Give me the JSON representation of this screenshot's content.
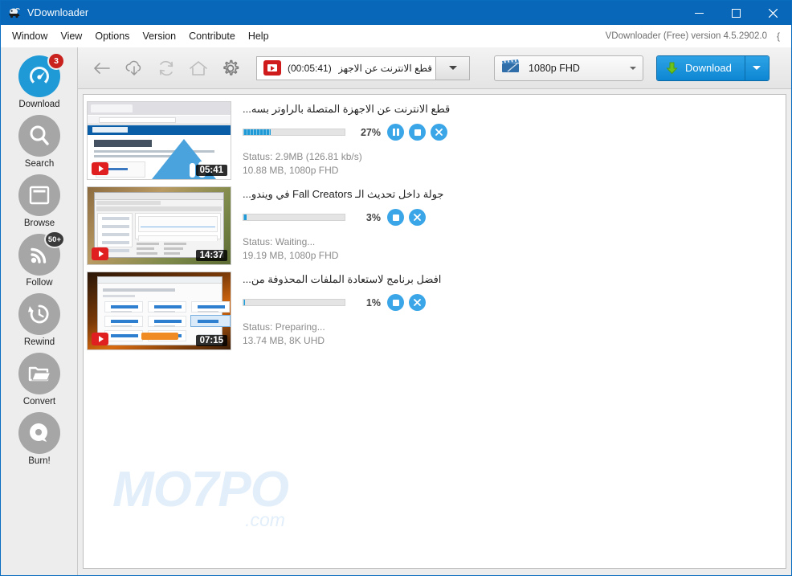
{
  "window": {
    "title": "VDownloader",
    "app_icon": "vdownloader-icon",
    "minimize_label": "—",
    "maximize_label": "□",
    "close_label": "✕"
  },
  "menubar": {
    "items": [
      {
        "label": "Window"
      },
      {
        "label": "View"
      },
      {
        "label": "Options"
      },
      {
        "label": "Version"
      },
      {
        "label": "Contribute"
      },
      {
        "label": "Help"
      }
    ],
    "version_text": "VDownloader (Free) version 4.5.2902.0",
    "version_glyph": "{"
  },
  "sidebar": {
    "items": [
      {
        "label": "Download",
        "icon": "speedometer-icon",
        "active": true,
        "badge": "3",
        "badge_style": "red"
      },
      {
        "label": "Search",
        "icon": "magnifier-icon",
        "active": false,
        "badge": null
      },
      {
        "label": "Browse",
        "icon": "window-icon",
        "active": false,
        "badge": null
      },
      {
        "label": "Follow",
        "icon": "rss-icon",
        "active": false,
        "badge": "50+",
        "badge_style": "dark"
      },
      {
        "label": "Rewind",
        "icon": "clock-rewind-icon",
        "active": false,
        "badge": null
      },
      {
        "label": "Convert",
        "icon": "folder-open-icon",
        "active": false,
        "badge": null
      },
      {
        "label": "Burn!",
        "icon": "disc-icon",
        "active": false,
        "badge": null
      }
    ]
  },
  "toolbar": {
    "icons": [
      {
        "name": "back-icon"
      },
      {
        "name": "cloud-download-icon"
      },
      {
        "name": "refresh-icon"
      },
      {
        "name": "home-icon"
      },
      {
        "name": "settings-gear-icon"
      }
    ],
    "url_field": {
      "text": "قطع الانترنت عن الاجهزة",
      "duration": "(00:05:41)",
      "source_icon": "youtube-icon"
    },
    "url_dropdown": "chevron-down-icon",
    "quality": {
      "value": "1080p FHD",
      "icon": "clapperboard-icon",
      "dropdown": "chevron-down-icon"
    },
    "download_button": {
      "label": "Download",
      "icon": "download-arrow-icon",
      "split_icon": "chevron-down-icon"
    }
  },
  "downloads": [
    {
      "title": "قطع الانترنت عن الاجهزة المتصلة بالراوتر بسه...",
      "duration": "05:41",
      "percent": "27%",
      "percent_value": 27,
      "status": "Status: 2.9MB (126.81 kb/s)",
      "meta": "10.88 MB,   1080p FHD",
      "source_icon": "youtube-icon",
      "controls": [
        "pause-button",
        "stop-button",
        "cancel-button"
      ],
      "thumb": "t1"
    },
    {
      "title": "جولة داخل تحديث الـ Fall Creators في ويندو...",
      "duration": "14:37",
      "percent": "3%",
      "percent_value": 3,
      "status": "Status: Waiting...",
      "meta": "19.19 MB,   1080p FHD",
      "source_icon": "youtube-icon",
      "controls": [
        "stop-button",
        "cancel-button"
      ],
      "thumb": "t2"
    },
    {
      "title": "افضل برنامج لاستعادة الملفات المحذوفة من...",
      "duration": "07:15",
      "percent": "1%",
      "percent_value": 1,
      "status": "Status: Preparing...",
      "meta": "13.74 MB,   8K UHD",
      "source_icon": "youtube-icon",
      "controls": [
        "stop-button",
        "cancel-button"
      ],
      "thumb": "t3"
    }
  ],
  "watermark": {
    "main": "MO7PO",
    "sub": ".com"
  },
  "colors": {
    "titlebar": "#0867b8",
    "accent_blue": "#1f9ad6",
    "badge_red": "#c9211e",
    "sidebar_bg": "#ededed",
    "download_button": "#0d86d2"
  }
}
